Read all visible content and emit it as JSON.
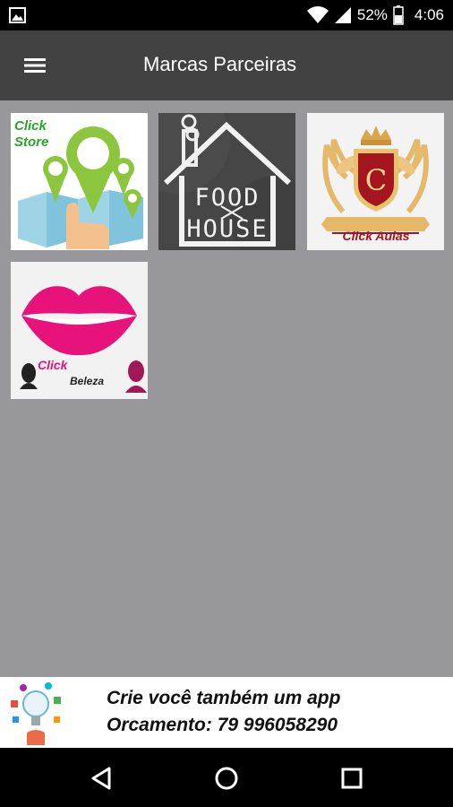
{
  "status_bar": {
    "battery_percent": "52%",
    "time": "4:06",
    "icons": [
      "gallery-icon",
      "wifi-icon",
      "signal-icon",
      "battery-icon"
    ]
  },
  "app_bar": {
    "title": "Marcas Parceiras",
    "menu_icon": "menu-icon"
  },
  "partners": [
    {
      "name": "click-store",
      "line1": "Click",
      "line2": "Store"
    },
    {
      "name": "food-house",
      "line1": "FOOD",
      "line2": "HOUSE"
    },
    {
      "name": "click-aulas",
      "letter": "C",
      "label": "Click Aulas"
    },
    {
      "name": "click-beleza",
      "line1": "Click",
      "line2": "Beleza"
    }
  ],
  "ad_banner": {
    "line1": "Crie você também um app",
    "line2": "Orcamento: 79 996058290"
  },
  "nav_bar": {
    "icons": [
      "back-icon",
      "home-icon",
      "recents-icon"
    ]
  },
  "colors": {
    "status_bar": "#000000",
    "app_bar": "#424242",
    "background": "#98979c",
    "beleza_pink": "#e8137a",
    "store_green": "#8cc63f",
    "aulas_red": "#a3151f"
  }
}
